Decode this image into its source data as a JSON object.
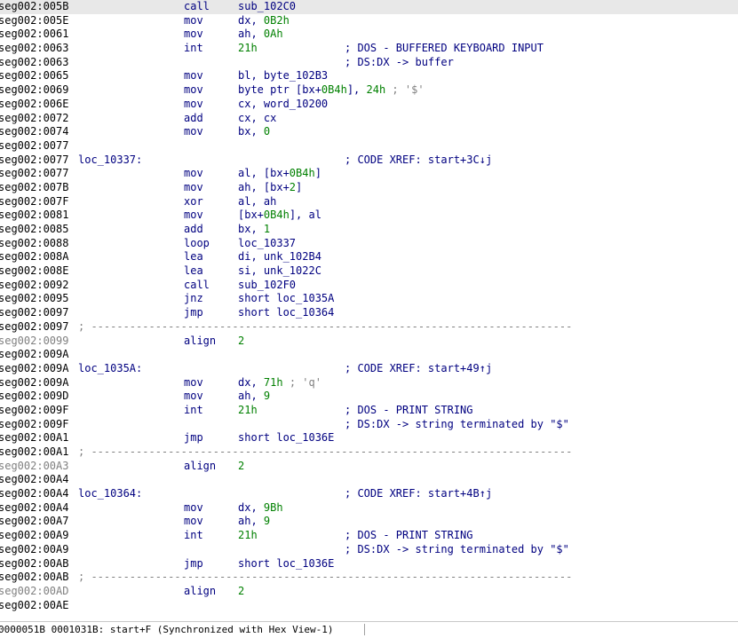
{
  "listing": [
    {
      "addr": "seg002:005B",
      "mnemonic": "call",
      "operands": [
        {
          "t": "sub_102C0"
        }
      ]
    },
    {
      "addr": "seg002:005E",
      "mnemonic": "mov",
      "operands": [
        {
          "t": "dx, "
        },
        {
          "t": "0B2h",
          "num": true
        }
      ]
    },
    {
      "addr": "seg002:0061",
      "mnemonic": "mov",
      "operands": [
        {
          "t": "ah, "
        },
        {
          "t": "0Ah",
          "num": true
        }
      ]
    },
    {
      "addr": "seg002:0063",
      "mnemonic": "int",
      "operands": [
        {
          "t": "21h",
          "num": true
        }
      ],
      "comment": "; DOS - BUFFERED KEYBOARD INPUT"
    },
    {
      "addr": "seg002:0063",
      "comment": "; DS:DX -> buffer"
    },
    {
      "addr": "seg002:0065",
      "mnemonic": "mov",
      "operands": [
        {
          "t": "bl, byte_102B3"
        }
      ]
    },
    {
      "addr": "seg002:0069",
      "mnemonic": "mov",
      "operands": [
        {
          "t": "byte ptr [bx+"
        },
        {
          "t": "0B4h",
          "num": true
        },
        {
          "t": "], "
        },
        {
          "t": "24h",
          "num": true
        },
        {
          "t": " ; '$'",
          "str": true
        }
      ]
    },
    {
      "addr": "seg002:006E",
      "mnemonic": "mov",
      "operands": [
        {
          "t": "cx, word_10200"
        }
      ]
    },
    {
      "addr": "seg002:0072",
      "mnemonic": "add",
      "operands": [
        {
          "t": "cx, cx"
        }
      ]
    },
    {
      "addr": "seg002:0074",
      "mnemonic": "mov",
      "operands": [
        {
          "t": "bx, "
        },
        {
          "t": "0",
          "num": true
        }
      ]
    },
    {
      "addr": "seg002:0077"
    },
    {
      "addr": "seg002:0077",
      "label": "loc_10337:",
      "comment": "; CODE XREF: start+3C↓j"
    },
    {
      "addr": "seg002:0077",
      "mnemonic": "mov",
      "operands": [
        {
          "t": "al, [bx+"
        },
        {
          "t": "0B4h",
          "num": true
        },
        {
          "t": "]"
        }
      ]
    },
    {
      "addr": "seg002:007B",
      "mnemonic": "mov",
      "operands": [
        {
          "t": "ah, [bx+"
        },
        {
          "t": "2",
          "num": true
        },
        {
          "t": "]"
        }
      ]
    },
    {
      "addr": "seg002:007F",
      "mnemonic": "xor",
      "operands": [
        {
          "t": "al, ah"
        }
      ]
    },
    {
      "addr": "seg002:0081",
      "mnemonic": "mov",
      "operands": [
        {
          "t": "[bx+"
        },
        {
          "t": "0B4h",
          "num": true
        },
        {
          "t": "], al"
        }
      ]
    },
    {
      "addr": "seg002:0085",
      "mnemonic": "add",
      "operands": [
        {
          "t": "bx, "
        },
        {
          "t": "1",
          "num": true
        }
      ]
    },
    {
      "addr": "seg002:0088",
      "mnemonic": "loop",
      "operands": [
        {
          "t": "loc_10337"
        }
      ]
    },
    {
      "addr": "seg002:008A",
      "mnemonic": "lea",
      "operands": [
        {
          "t": "di, unk_102B4"
        }
      ]
    },
    {
      "addr": "seg002:008E",
      "mnemonic": "lea",
      "operands": [
        {
          "t": "si, unk_1022C"
        }
      ]
    },
    {
      "addr": "seg002:0092",
      "mnemonic": "call",
      "operands": [
        {
          "t": "sub_102F0"
        }
      ]
    },
    {
      "addr": "seg002:0095",
      "mnemonic": "jnz",
      "operands": [
        {
          "t": "short loc_1035A"
        }
      ]
    },
    {
      "addr": "seg002:0097",
      "mnemonic": "jmp",
      "operands": [
        {
          "t": "short loc_10364"
        }
      ]
    },
    {
      "addr": "seg002:0097",
      "separator": "; ---------------------------------------------------------------------------"
    },
    {
      "addr": "seg002:0099",
      "gray": true,
      "mnemonic": "align",
      "operands": [
        {
          "t": "2",
          "num": true
        }
      ]
    },
    {
      "addr": "seg002:009A"
    },
    {
      "addr": "seg002:009A",
      "label": "loc_1035A:",
      "comment": "; CODE XREF: start+49↑j"
    },
    {
      "addr": "seg002:009A",
      "mnemonic": "mov",
      "operands": [
        {
          "t": "dx, "
        },
        {
          "t": "71h",
          "num": true
        },
        {
          "t": " ; 'q'",
          "str": true
        }
      ]
    },
    {
      "addr": "seg002:009D",
      "mnemonic": "mov",
      "operands": [
        {
          "t": "ah, "
        },
        {
          "t": "9",
          "num": true
        }
      ]
    },
    {
      "addr": "seg002:009F",
      "mnemonic": "int",
      "operands": [
        {
          "t": "21h",
          "num": true
        }
      ],
      "comment": "; DOS - PRINT STRING"
    },
    {
      "addr": "seg002:009F",
      "comment": "; DS:DX -> string terminated by \"$\""
    },
    {
      "addr": "seg002:00A1",
      "mnemonic": "jmp",
      "operands": [
        {
          "t": "short loc_1036E"
        }
      ]
    },
    {
      "addr": "seg002:00A1",
      "separator": "; ---------------------------------------------------------------------------"
    },
    {
      "addr": "seg002:00A3",
      "gray": true,
      "mnemonic": "align",
      "operands": [
        {
          "t": "2",
          "num": true
        }
      ]
    },
    {
      "addr": "seg002:00A4"
    },
    {
      "addr": "seg002:00A4",
      "label": "loc_10364:",
      "comment": "; CODE XREF: start+4B↑j"
    },
    {
      "addr": "seg002:00A4",
      "mnemonic": "mov",
      "operands": [
        {
          "t": "dx, "
        },
        {
          "t": "9Bh",
          "num": true
        }
      ]
    },
    {
      "addr": "seg002:00A7",
      "mnemonic": "mov",
      "operands": [
        {
          "t": "ah, "
        },
        {
          "t": "9",
          "num": true
        }
      ]
    },
    {
      "addr": "seg002:00A9",
      "mnemonic": "int",
      "operands": [
        {
          "t": "21h",
          "num": true
        }
      ],
      "comment": "; DOS - PRINT STRING"
    },
    {
      "addr": "seg002:00A9",
      "comment": "; DS:DX -> string terminated by \"$\""
    },
    {
      "addr": "seg002:00AB",
      "mnemonic": "jmp",
      "operands": [
        {
          "t": "short loc_1036E"
        }
      ]
    },
    {
      "addr": "seg002:00AB",
      "separator": "; ---------------------------------------------------------------------------"
    },
    {
      "addr": "seg002:00AD",
      "gray": true,
      "mnemonic": "align",
      "operands": [
        {
          "t": "2",
          "num": true
        }
      ]
    },
    {
      "addr": "seg002:00AE"
    }
  ],
  "status_bar": {
    "text": "0000051B 0001031B: start+F (Synchronized with Hex View-1)"
  },
  "colors": {
    "address": "#000000",
    "code": "#000080",
    "number": "#008000",
    "comment_gray": "#808080",
    "selected_row": "#e8e8e8"
  }
}
